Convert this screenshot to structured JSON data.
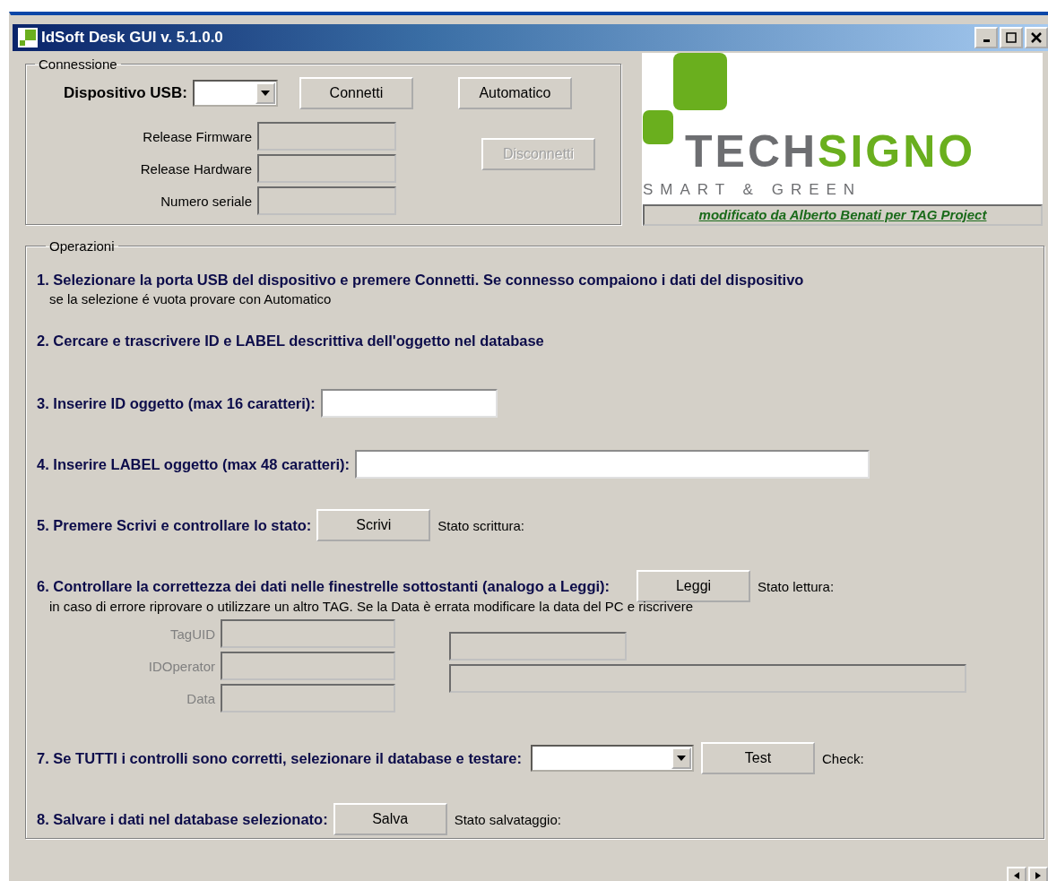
{
  "window": {
    "title": "IdSoft Desk GUI v. 5.1.0.0"
  },
  "connection": {
    "title": "Connessione",
    "device_label": "Dispositivo USB:",
    "buttons": [
      {
        "label": "Connetti",
        "disabled": false
      },
      {
        "label": "Automatico",
        "disabled": false
      },
      {
        "label": "Disconnetti",
        "disabled": true
      }
    ],
    "fields": [
      {
        "label": "Release Firmware",
        "disabled": false
      },
      {
        "label": "Release Hardware",
        "disabled": false
      },
      {
        "label": "Numero seriale",
        "disabled": false
      }
    ]
  },
  "logo": {
    "wordmark_dark": "TECH",
    "wordmark_green": "SIGNO",
    "tagline": "SMART & GREEN",
    "credit": "modificato da Alberto Benati per TAG Project"
  },
  "operations": {
    "title": "Operazioni",
    "steps": [
      {
        "kind": "text",
        "text": "1. Selezionare la porta USB del dispositivo e premere Connetti. Se connesso compaiono i dati del dispositivo",
        "note": "se la selezione é vuota provare con Automatico"
      },
      {
        "kind": "text",
        "text": "2. Cercare e trascrivere ID e LABEL descrittiva dell'oggetto nel database"
      },
      {
        "kind": "input",
        "text": "3. Inserire ID oggetto (max 16 caratteri):",
        "wide": false
      },
      {
        "kind": "input",
        "text": "4. Inserire LABEL oggetto (max 48 caratteri):",
        "wide": true
      },
      {
        "kind": "button",
        "text": "5. Premere Scrivi e controllare lo stato:",
        "button": "Scrivi",
        "status": "Stato scrittura:"
      },
      {
        "kind": "read",
        "text": "6. Controllare la correttezza dei dati nelle finestrelle sottostanti (analogo a Leggi):",
        "button": "Leggi",
        "status": "Stato lettura:",
        "note": "in caso di errore riprovare o utilizzare un altro TAG. Se la Data è errata modificare la data del PC e riscrivere",
        "fields": [
          {
            "label": "TagUID",
            "disabled": true
          },
          {
            "label": "IDOperator",
            "disabled": true
          },
          {
            "label": "Data",
            "disabled": true
          }
        ]
      },
      {
        "kind": "select",
        "text": "7. Se TUTTI i controlli sono corretti, selezionare il database e testare:",
        "button": "Test",
        "status": "Check:"
      },
      {
        "kind": "button",
        "text": "8. Salvare i dati nel database selezionato:",
        "button": "Salva",
        "status": "Stato salvataggio:"
      }
    ]
  }
}
